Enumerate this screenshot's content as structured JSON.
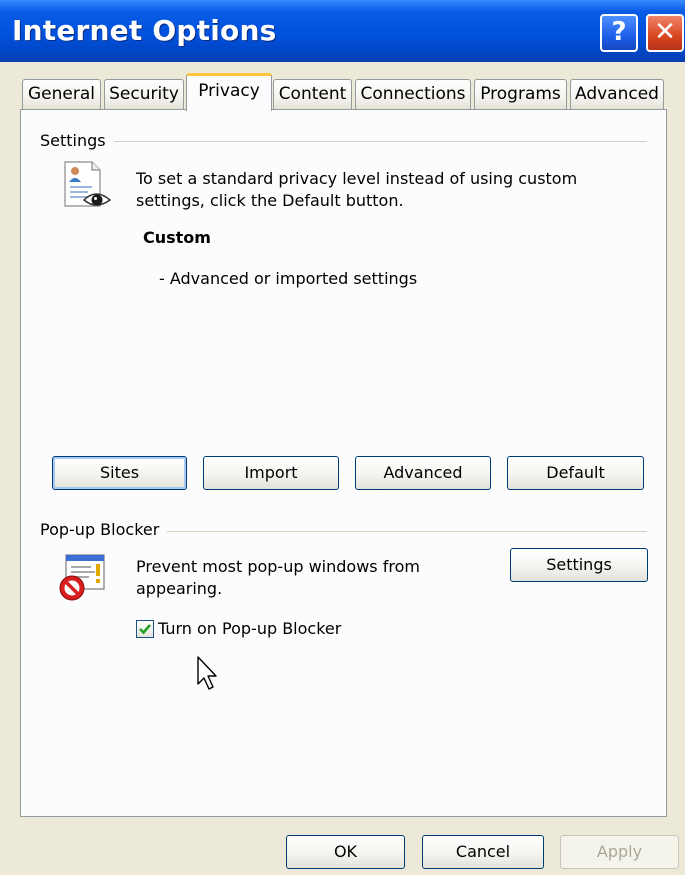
{
  "window": {
    "title": "Internet Options",
    "help_glyph": "?",
    "close_glyph": "✕"
  },
  "tabs": [
    {
      "label": "General"
    },
    {
      "label": "Security"
    },
    {
      "label": "Privacy",
      "active": true
    },
    {
      "label": "Content"
    },
    {
      "label": "Connections"
    },
    {
      "label": "Programs"
    },
    {
      "label": "Advanced"
    }
  ],
  "settings": {
    "group_label": "Settings",
    "description": "To set a standard privacy level instead of using custom settings, click the Default button.",
    "level_name": "Custom",
    "level_detail": "- Advanced or imported settings",
    "buttons": {
      "sites": "Sites",
      "import": "Import",
      "advanced": "Advanced",
      "default": "Default"
    },
    "icon": "privacy-document-eye-icon"
  },
  "popup_blocker": {
    "group_label": "Pop-up Blocker",
    "description_line1": "Prevent most pop-up windows from",
    "description_line2": "appearing.",
    "settings_button": "Settings",
    "checkbox_label": "Turn on Pop-up Blocker",
    "checkbox_checked": true,
    "icon": "popup-blocked-icon"
  },
  "footer": {
    "ok": "OK",
    "cancel": "Cancel",
    "apply": "Apply",
    "apply_enabled": false
  },
  "colors": {
    "titlebar": "#0052de",
    "dialog_bg": "#ece9d8",
    "panel_bg": "#fcfcfe",
    "active_tab_accent": "#ffc83c",
    "button_border": "#003c74"
  }
}
